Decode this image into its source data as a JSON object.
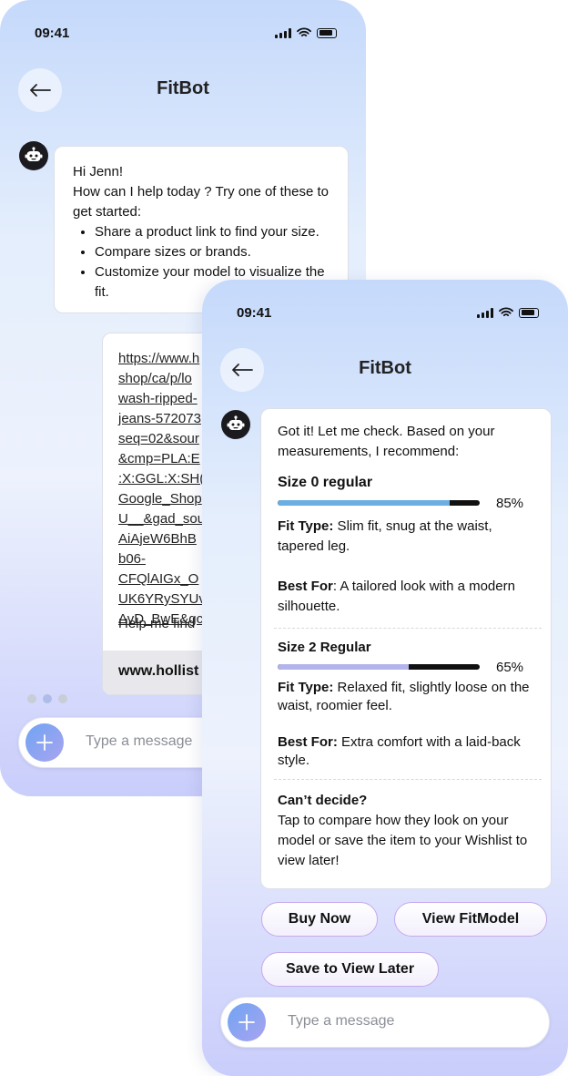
{
  "screen1": {
    "time": "09:41",
    "title": "FitBot",
    "greeting": {
      "line1": "Hi Jenn!",
      "line2": "How can I help today ? Try one of these to get started:",
      "items": [
        "Share a product link to find your size.",
        "Compare sizes or brands.",
        "Customize your model to visualize the fit."
      ]
    },
    "link_message": {
      "text": "https://www.h\nshop/ca/p/lo\nwash-ripped-\njeans-572073\nseq=02&sour\n&cmp=PLA:E\n:X:GGL:X:SH(\nGoogle_Shop\nU__&gad_sou\nAiAjeW6BhB\nb06-\nCFQlAIGx_O\nUK6YRySYUv\nAvD_BwE&gc",
      "overlap_text": "Help me find",
      "domain": "www.hollist"
    },
    "input_placeholder": "Type a message"
  },
  "screen2": {
    "time": "09:41",
    "title": "FitBot",
    "intro": "Got it! Let me check. Based on your measurements, I recommend:",
    "sizes": [
      {
        "name": "Size 0 regular",
        "match": 0.85,
        "percent_label": "85%",
        "bar_color": "#6aaee2",
        "fit_type_label": "Fit Type:",
        "fit_type": " Slim fit, snug at the waist, tapered leg.",
        "best_for_label": "Best For",
        "best_for": ": A tailored look with a modern silhouette."
      },
      {
        "name": "Size 2 Regular",
        "match": 0.65,
        "percent_label": "65%",
        "bar_color": "#b4b4ec",
        "fit_type_label": "Fit Type:",
        "fit_type": " Relaxed fit, slightly loose on the waist, roomier feel.",
        "best_for_label": "Best For:",
        "best_for": " Extra comfort with a laid-back style."
      }
    ],
    "cant_decide": {
      "title": "Can’t decide?",
      "text": "Tap to compare how they look on your model or save the item to your Wishlist to view later!"
    },
    "buttons": {
      "buy_now": "Buy Now",
      "view_fitmodel": "View FitModel",
      "save_later": "Save to View Later"
    },
    "input_placeholder": "Type a message"
  }
}
